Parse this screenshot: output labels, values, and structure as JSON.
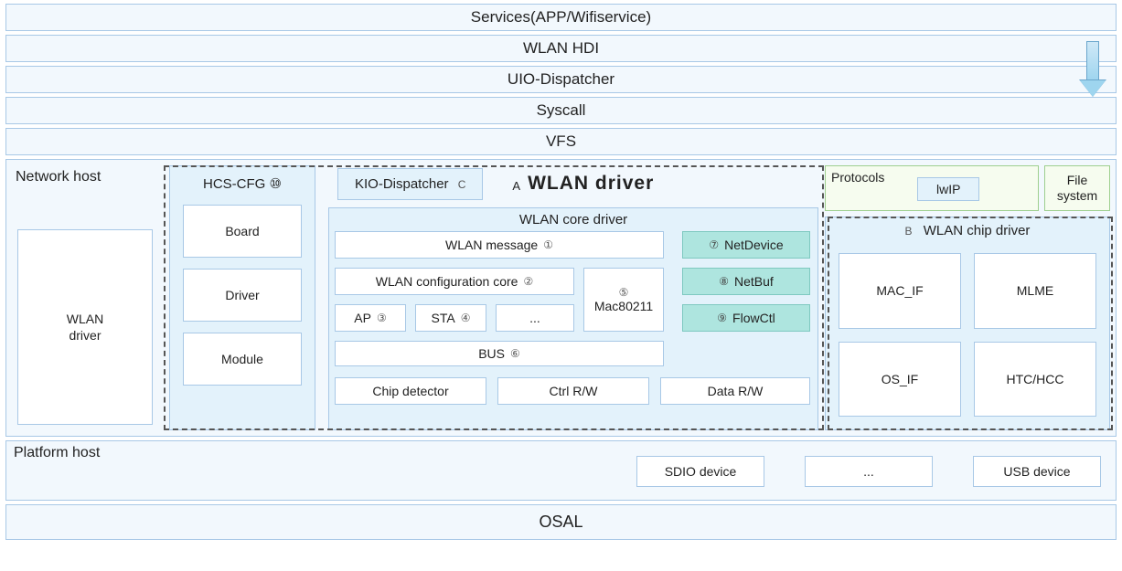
{
  "layers": {
    "services": "Services(APP/Wifiservice)",
    "hdi": "WLAN HDI",
    "uio": "UIO-Dispatcher",
    "syscall": "Syscall",
    "vfs": "VFS",
    "osal": "OSAL"
  },
  "network_host": {
    "label": "Network host",
    "wlan_driver": "WLAN\ndriver"
  },
  "hcs": {
    "title": "HCS-CFG ⑩",
    "board": "Board",
    "driver": "Driver",
    "module": "Module"
  },
  "driver_header": {
    "kio": "KIO-Dispatcher",
    "kio_tag": "C",
    "a_tag": "A",
    "title": "WLAN  driver"
  },
  "core": {
    "title": "WLAN core driver",
    "msg": "WLAN message",
    "msg_n": "①",
    "cfg": "WLAN configuration core",
    "cfg_n": "②",
    "ap": "AP",
    "ap_n": "③",
    "sta": "STA",
    "sta_n": "④",
    "dots": "...",
    "mac": "Mac80211",
    "mac_n": "⑤",
    "bus": "BUS",
    "bus_n": "⑥",
    "netdev": "NetDevice",
    "netdev_n": "⑦",
    "netbuf": "NetBuf",
    "netbuf_n": "⑧",
    "flow": "FlowCtl",
    "flow_n": "⑨",
    "chip_det": "Chip detector",
    "ctrl": "Ctrl R/W",
    "data": "Data R/W"
  },
  "side": {
    "protocols": "Protocols",
    "lwip": "lwIP",
    "fs": "File system"
  },
  "chip": {
    "tag": "B",
    "title": "WLAN chip driver",
    "mac_if": "MAC_IF",
    "mlme": "MLME",
    "os_if": "OS_IF",
    "htc": "HTC/HCC"
  },
  "platform": {
    "label": "Platform host",
    "sdio": "SDIO device",
    "dots": "...",
    "usb": "USB device"
  }
}
